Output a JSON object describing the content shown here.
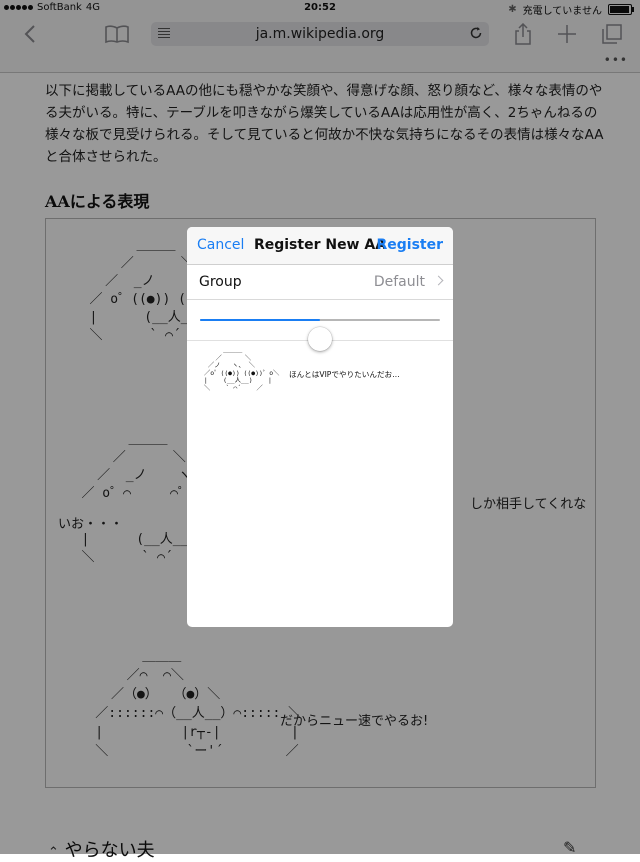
{
  "status_bar": {
    "carrier": "SoftBank",
    "network": "4G",
    "time": "20:52",
    "bluetooth": "✱",
    "charging_text": "充電していません",
    "battery_level": 0.95
  },
  "toolbar": {
    "back_icon": "chevron-left-icon",
    "bookmarks_icon": "book-icon",
    "reader_icon": "reader-lines-icon",
    "url": "ja.m.wikipedia.org",
    "reload_icon": "reload-icon",
    "share_icon": "share-icon",
    "add_icon": "plus-icon",
    "tabs_icon": "tabs-icon",
    "more": "•••"
  },
  "article": {
    "intro": "以下に掲載しているAAの他にも穏やかな笑顔や、得意げな顔、怒り顔など、様々な表情のやる夫がいる。特に、テーブルを叩きながら爆笑しているAAは応用性が高く、2ちゃんねるの様々な板で見受けられる。そして見ていると何故か不快な気持ちになるその表情は様々なAAと合体させられた。",
    "heading": "AAによる表現",
    "aa_1": "         ＿＿＿\n       ／      ＼\n     ／  _ノ    ヽ、_ ＼\n   ／ o゜((●)) ((●))゜o ＼\n   |      (__人__)     |\n   ＼      ` ⌒´     ／",
    "aa_2": "         ＿＿＿\n       ／      ＼\n     ／  _ノ    ヽ、_ ＼\n   ／ o゜⌒     ⌒゜o ＼\n",
    "aa_2_tail": "   |      (__人__)     |\n   ＼      ` ⌒´     ／",
    "aa_2_caption_a": "しか相手してくれな",
    "aa_2_caption_b": "いお・・・",
    "aa_3": "          ＿＿＿\n        ／⌒  ⌒＼\n      ／（●）  （●）＼\n    ／::::::⌒（__人__）⌒::::: ＼\n    |          |r┬-|         |\n    ＼          `ー'´        ／",
    "aa_3_caption": "だからニュー速でやるお!",
    "next_section": "やらない夫",
    "edit_icon": "pencil-icon"
  },
  "modal": {
    "cancel": "Cancel",
    "title": "Register New AA",
    "register": "Register",
    "group_label": "Group",
    "group_value": "Default",
    "slider_value": 0.5,
    "preview_aa": "      ＿＿＿\n    ／      ＼\n  ／ノ   ヽ、 ＼\n ／o゜((●)) ((●))゜o＼\n |    (__人__)    |\n ＼    ` ⌒´    ／",
    "preview_text": "ほんとはVIPでやりたいんだお…"
  }
}
